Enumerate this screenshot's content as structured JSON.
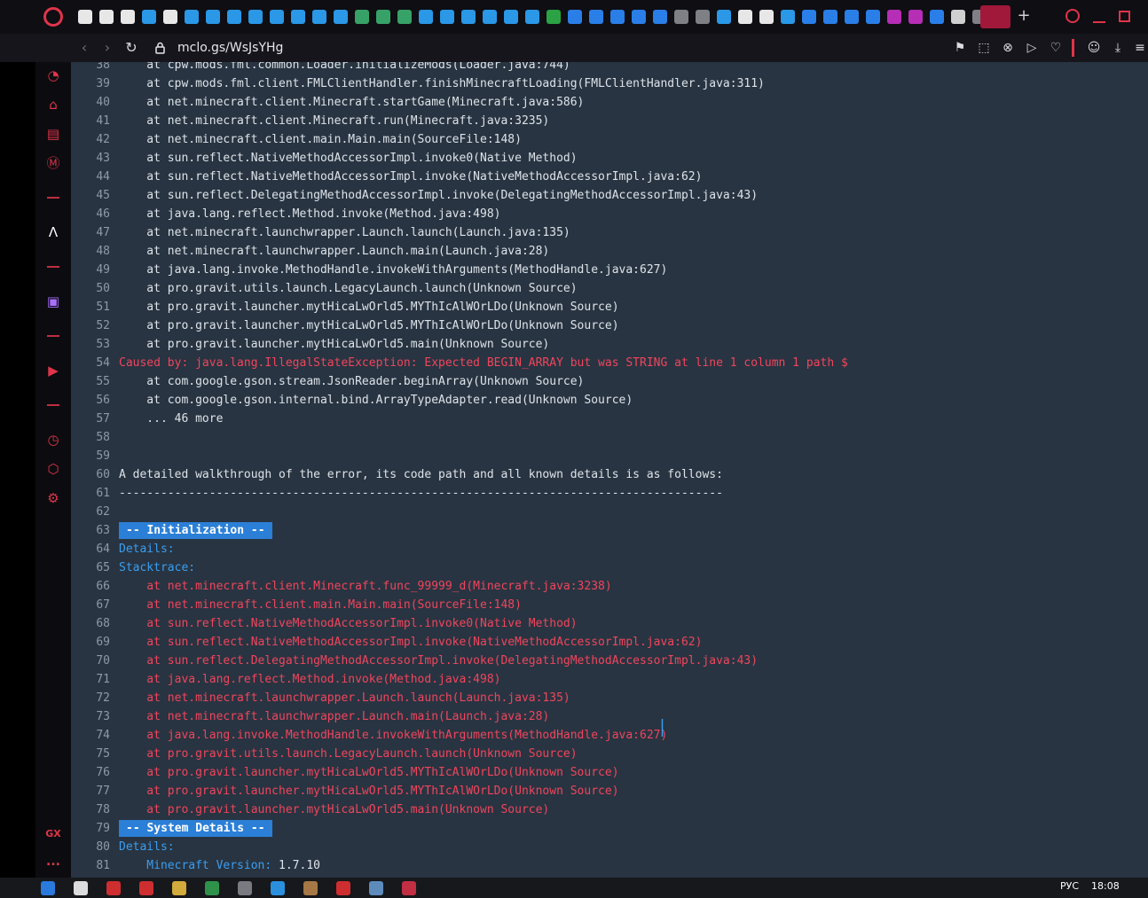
{
  "browser": {
    "url": "mclo.gs/WsJsYHg",
    "icons": [
      "opera-logo",
      "back-icon",
      "forward-icon",
      "reload-icon",
      "lock-icon",
      "pin-icon",
      "snapshot-icon",
      "block-icon",
      "send-icon",
      "heart-icon",
      "account-icon",
      "download-icon",
      "menu-icon"
    ],
    "accent_color": "#e0344a"
  },
  "sidebar": {
    "icons": [
      "speed-dial-icon",
      "bag-icon",
      "news-icon",
      "mail-icon",
      "aria-icon",
      "twitch-icon",
      "player-icon",
      "history-icon",
      "extensions-icon",
      "settings-icon"
    ],
    "gx_label": "GX",
    "more_label": "..."
  },
  "log": {
    "lines": [
      {
        "n": "38",
        "t": "    at cpw.mods.fml.common.Loader.initializeMods(Loader.java:744)",
        "s": "normal"
      },
      {
        "n": "39",
        "t": "    at cpw.mods.fml.client.FMLClientHandler.finishMinecraftLoading(FMLClientHandler.java:311)",
        "s": "normal"
      },
      {
        "n": "40",
        "t": "    at net.minecraft.client.Minecraft.startGame(Minecraft.java:586)",
        "s": "normal"
      },
      {
        "n": "41",
        "t": "    at net.minecraft.client.Minecraft.run(Minecraft.java:3235)",
        "s": "normal"
      },
      {
        "n": "42",
        "t": "    at net.minecraft.client.main.Main.main(SourceFile:148)",
        "s": "normal"
      },
      {
        "n": "43",
        "t": "    at sun.reflect.NativeMethodAccessorImpl.invoke0(Native Method)",
        "s": "normal"
      },
      {
        "n": "44",
        "t": "    at sun.reflect.NativeMethodAccessorImpl.invoke(NativeMethodAccessorImpl.java:62)",
        "s": "normal"
      },
      {
        "n": "45",
        "t": "    at sun.reflect.DelegatingMethodAccessorImpl.invoke(DelegatingMethodAccessorImpl.java:43)",
        "s": "normal"
      },
      {
        "n": "46",
        "t": "    at java.lang.reflect.Method.invoke(Method.java:498)",
        "s": "normal"
      },
      {
        "n": "47",
        "t": "    at net.minecraft.launchwrapper.Launch.launch(Launch.java:135)",
        "s": "normal"
      },
      {
        "n": "48",
        "t": "    at net.minecraft.launchwrapper.Launch.main(Launch.java:28)",
        "s": "normal"
      },
      {
        "n": "49",
        "t": "    at java.lang.invoke.MethodHandle.invokeWithArguments(MethodHandle.java:627)",
        "s": "normal"
      },
      {
        "n": "50",
        "t": "    at pro.gravit.utils.launch.LegacyLaunch.launch(Unknown Source)",
        "s": "normal"
      },
      {
        "n": "51",
        "t": "    at pro.gravit.launcher.mytHicaLwOrld5.MYThIcAlWOrLDo(Unknown Source)",
        "s": "normal"
      },
      {
        "n": "52",
        "t": "    at pro.gravit.launcher.mytHicaLwOrld5.MYThIcAlWOrLDo(Unknown Source)",
        "s": "normal"
      },
      {
        "n": "53",
        "t": "    at pro.gravit.launcher.mytHicaLwOrld5.main(Unknown Source)",
        "s": "normal"
      },
      {
        "n": "54",
        "t": "Caused by: java.lang.IllegalStateException: Expected BEGIN_ARRAY but was STRING at line 1 column 1 path $",
        "s": "red"
      },
      {
        "n": "55",
        "t": "    at com.google.gson.stream.JsonReader.beginArray(Unknown Source)",
        "s": "normal"
      },
      {
        "n": "56",
        "t": "    at com.google.gson.internal.bind.ArrayTypeAdapter.read(Unknown Source)",
        "s": "normal"
      },
      {
        "n": "57",
        "t": "    ... 46 more",
        "s": "normal"
      },
      {
        "n": "58",
        "t": "",
        "s": "normal"
      },
      {
        "n": "59",
        "t": "",
        "s": "normal"
      },
      {
        "n": "60",
        "t": "A detailed walkthrough of the error, its code path and all known details is as follows:",
        "s": "normal"
      },
      {
        "n": "61",
        "t": "---------------------------------------------------------------------------------------",
        "s": "normal"
      },
      {
        "n": "62",
        "t": "",
        "s": "normal"
      },
      {
        "n": "63",
        "t": "-- Initialization --",
        "s": "header"
      },
      {
        "n": "64",
        "t": "Details:",
        "s": "blue"
      },
      {
        "n": "65",
        "t": "Stacktrace:",
        "s": "blue"
      },
      {
        "n": "66",
        "t": "    at net.minecraft.client.Minecraft.func_99999_d(Minecraft.java:3238)",
        "s": "red"
      },
      {
        "n": "67",
        "t": "    at net.minecraft.client.main.Main.main(SourceFile:148)",
        "s": "red"
      },
      {
        "n": "68",
        "t": "    at sun.reflect.NativeMethodAccessorImpl.invoke0(Native Method)",
        "s": "red"
      },
      {
        "n": "69",
        "t": "    at sun.reflect.NativeMethodAccessorImpl.invoke(NativeMethodAccessorImpl.java:62)",
        "s": "red"
      },
      {
        "n": "70",
        "t": "    at sun.reflect.DelegatingMethodAccessorImpl.invoke(DelegatingMethodAccessorImpl.java:43)",
        "s": "red"
      },
      {
        "n": "71",
        "t": "    at java.lang.reflect.Method.invoke(Method.java:498)",
        "s": "red"
      },
      {
        "n": "72",
        "t": "    at net.minecraft.launchwrapper.Launch.launch(Launch.java:135)",
        "s": "red"
      },
      {
        "n": "73",
        "t": "    at net.minecraft.launchwrapper.Launch.main(Launch.java:28)",
        "s": "red"
      },
      {
        "n": "74",
        "t": "    at java.lang.invoke.MethodHandle.invokeWithArguments(MethodHandle.java:627)",
        "s": "red"
      },
      {
        "n": "75",
        "t": "    at pro.gravit.utils.launch.LegacyLaunch.launch(Unknown Source)",
        "s": "red"
      },
      {
        "n": "76",
        "t": "    at pro.gravit.launcher.mytHicaLwOrld5.MYThIcAlWOrLDo(Unknown Source)",
        "s": "red"
      },
      {
        "n": "77",
        "t": "    at pro.gravit.launcher.mytHicaLwOrld5.MYThIcAlWOrLDo(Unknown Source)",
        "s": "red"
      },
      {
        "n": "78",
        "t": "    at pro.gravit.launcher.mytHicaLwOrld5.main(Unknown Source)",
        "s": "red"
      },
      {
        "n": "79",
        "t": "-- System Details --",
        "s": "header"
      },
      {
        "n": "80",
        "t": "Details:",
        "s": "blue"
      },
      {
        "n": "81",
        "t": "    Minecraft Version: 1.7.10",
        "s": "kv",
        "k": "    Minecraft Version:",
        "v": " 1.7.10"
      }
    ]
  },
  "taskbar": {
    "language": "РУС",
    "clock": "18:08"
  }
}
